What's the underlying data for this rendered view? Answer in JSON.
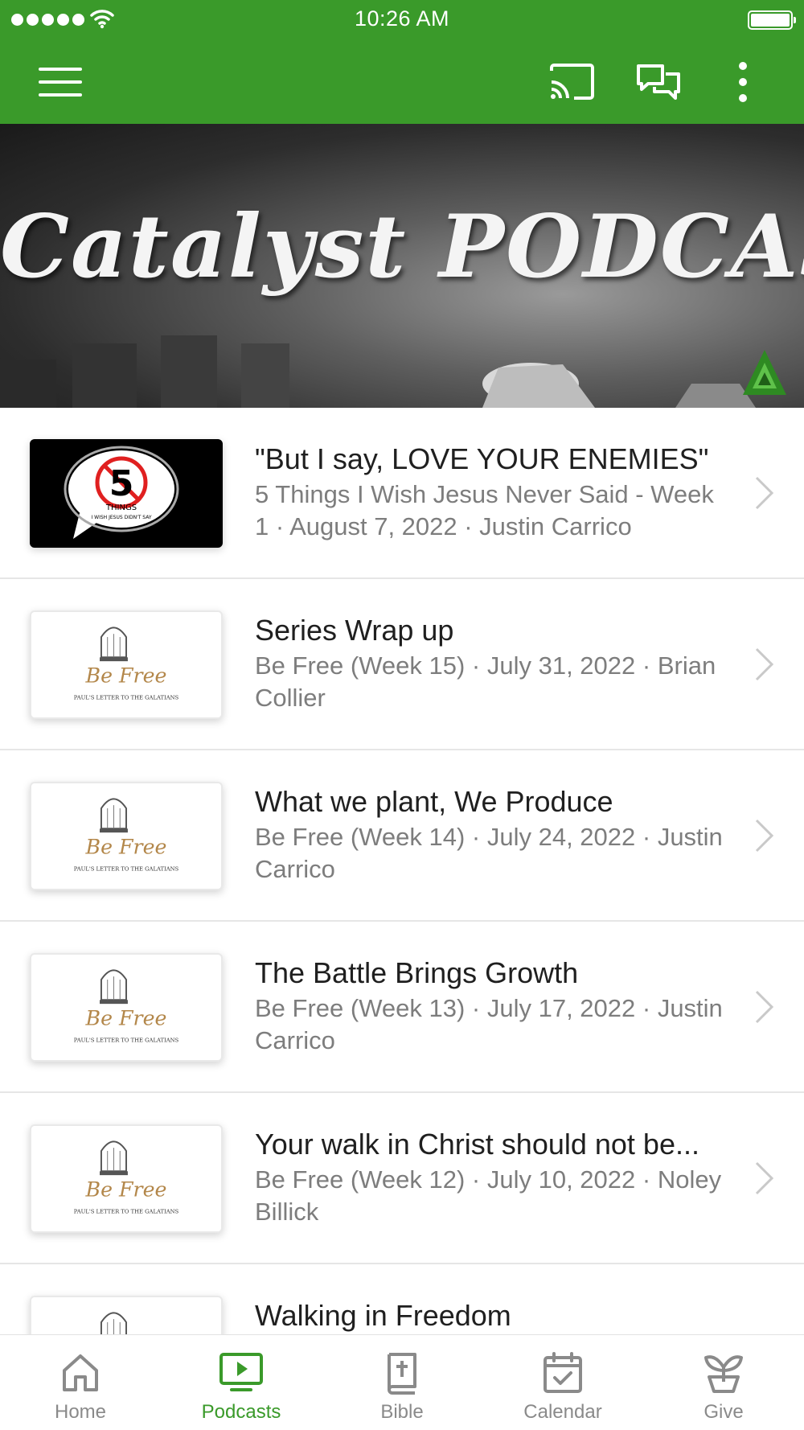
{
  "status_bar": {
    "time": "10:26 AM"
  },
  "header": {
    "menu_icon": "hamburger-menu-icon",
    "cast_icon": "cast-icon",
    "chat_icon": "chat-bubbles-icon",
    "more_icon": "more-vertical-icon",
    "color": "#3a9a2a"
  },
  "banner": {
    "title": "Catalyst PODCAST"
  },
  "episodes": [
    {
      "title": "\"But I say, LOVE YOUR ENEMIES\"",
      "subtitle": "5 Things I Wish Jesus Never Said - Week 1 · August 7, 2022 · Justin Carrico",
      "thumb": "5-things"
    },
    {
      "title": "Series Wrap up",
      "subtitle": "Be Free (Week 15) · July 31, 2022 · Brian Collier",
      "thumb": "be-free"
    },
    {
      "title": "What we plant, We Produce",
      "subtitle": "Be Free (Week 14) · July 24, 2022 · Justin Carrico",
      "thumb": "be-free"
    },
    {
      "title": "The Battle Brings Growth",
      "subtitle": "Be Free (Week 13) · July 17, 2022 · Justin Carrico",
      "thumb": "be-free"
    },
    {
      "title": "Your walk in Christ should not be...",
      "subtitle": "Be Free (Week 12) · July 10, 2022 · Noley Billick",
      "thumb": "be-free"
    },
    {
      "title": "Walking in Freedom",
      "subtitle": "",
      "thumb": "be-free"
    }
  ],
  "thumbs": {
    "five_things": {
      "big": "5",
      "line1": "THINGS",
      "line2": "I WISH JESUS DIDN'T SAY"
    },
    "be_free": {
      "script": "Be Free",
      "caption": "PAUL'S LETTER TO THE GALATIANS"
    }
  },
  "tabs": [
    {
      "label": "Home",
      "icon": "home-icon",
      "active": false
    },
    {
      "label": "Podcasts",
      "icon": "podcast-play-icon",
      "active": true
    },
    {
      "label": "Bible",
      "icon": "bible-icon",
      "active": false
    },
    {
      "label": "Calendar",
      "icon": "calendar-icon",
      "active": false
    },
    {
      "label": "Give",
      "icon": "give-plant-icon",
      "active": false
    }
  ]
}
